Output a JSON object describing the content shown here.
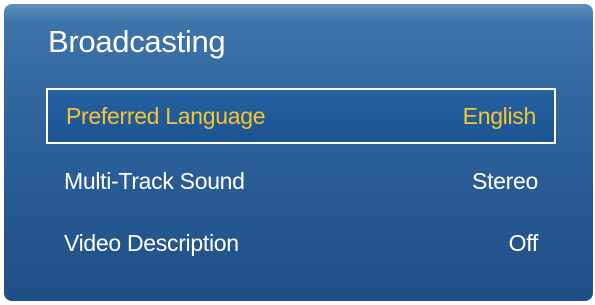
{
  "panel": {
    "title": "Broadcasting"
  },
  "menu": {
    "items": [
      {
        "label": "Preferred Language",
        "value": "English",
        "selected": true
      },
      {
        "label": "Multi-Track Sound",
        "value": "Stereo",
        "selected": false
      },
      {
        "label": "Video Description",
        "value": "Off",
        "selected": false
      }
    ]
  },
  "colors": {
    "panel_background": "#2d6199",
    "selected_text": "#f7c531",
    "normal_text": "#ffffff",
    "focus_border": "#ffffff"
  }
}
